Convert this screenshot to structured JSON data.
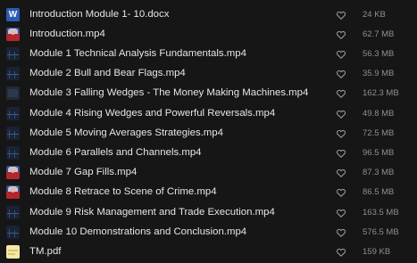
{
  "files": [
    {
      "name": "Introduction Module 1- 10.docx",
      "size": "24 KB",
      "thumb": "word-doc-icon"
    },
    {
      "name": "Introduction.mp4",
      "size": "62.7 MB",
      "thumb": "video-thumbnail-presenter"
    },
    {
      "name": "Module 1 Technical Analysis Fundamentals.mp4",
      "size": "56.3 MB",
      "thumb": "video-thumbnail-chart"
    },
    {
      "name": "Module 2 Bull and Bear Flags.mp4",
      "size": "35.9 MB",
      "thumb": "video-thumbnail-chart"
    },
    {
      "name": "Module 3 Falling Wedges - The Money Making Machines.mp4",
      "size": "162.3 MB",
      "thumb": "video-thumbnail-dark"
    },
    {
      "name": "Module 4 Rising Wedges and Powerful Reversals.mp4",
      "size": "49.8 MB",
      "thumb": "video-thumbnail-chart"
    },
    {
      "name": "Module 5 Moving Averages Strategies.mp4",
      "size": "72.5 MB",
      "thumb": "video-thumbnail-chart"
    },
    {
      "name": "Module 6 Parallels and Channels.mp4",
      "size": "96.5 MB",
      "thumb": "video-thumbnail-chart"
    },
    {
      "name": "Module 7 Gap Fills.mp4",
      "size": "87.3 MB",
      "thumb": "video-thumbnail-presenter"
    },
    {
      "name": "Module 8 Retrace to Scene of Crime.mp4",
      "size": "86.5 MB",
      "thumb": "video-thumbnail-presenter"
    },
    {
      "name": "Module 9 Risk Management and Trade Execution.mp4",
      "size": "163.5 MB",
      "thumb": "video-thumbnail-chart"
    },
    {
      "name": "Module 10 Demonstrations and Conclusion.mp4",
      "size": "576.5 MB",
      "thumb": "video-thumbnail-chart"
    },
    {
      "name": "TM.pdf",
      "size": "159 KB",
      "thumb": "pdf-thumbnail"
    }
  ],
  "docx_letter": "W",
  "colors": {
    "background": "#161616",
    "text": "#e6e6e6",
    "size_text": "#8e8e8e",
    "heart": "#9a9a9a"
  }
}
